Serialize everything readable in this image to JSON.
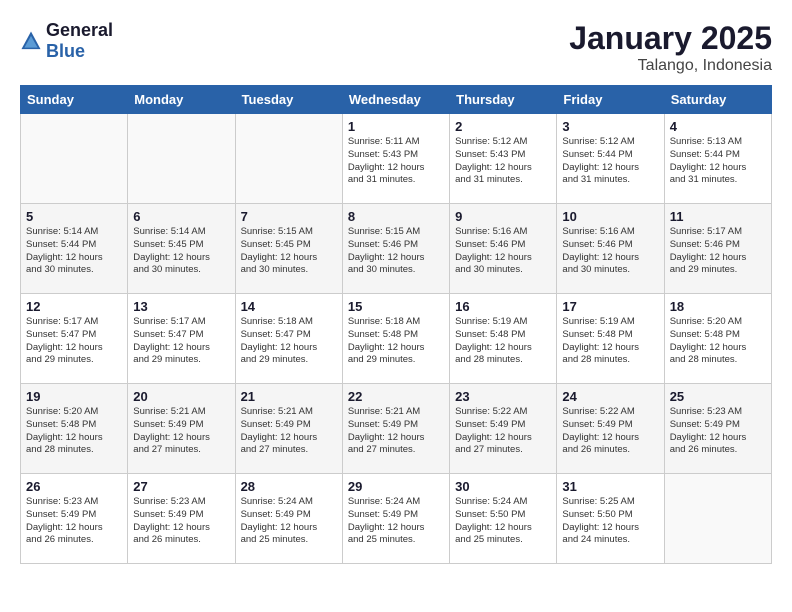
{
  "header": {
    "logo_general": "General",
    "logo_blue": "Blue",
    "title": "January 2025",
    "subtitle": "Talango, Indonesia"
  },
  "days_of_week": [
    "Sunday",
    "Monday",
    "Tuesday",
    "Wednesday",
    "Thursday",
    "Friday",
    "Saturday"
  ],
  "weeks": [
    [
      {
        "day": "",
        "info": ""
      },
      {
        "day": "",
        "info": ""
      },
      {
        "day": "",
        "info": ""
      },
      {
        "day": "1",
        "info": "Sunrise: 5:11 AM\nSunset: 5:43 PM\nDaylight: 12 hours\nand 31 minutes."
      },
      {
        "day": "2",
        "info": "Sunrise: 5:12 AM\nSunset: 5:43 PM\nDaylight: 12 hours\nand 31 minutes."
      },
      {
        "day": "3",
        "info": "Sunrise: 5:12 AM\nSunset: 5:44 PM\nDaylight: 12 hours\nand 31 minutes."
      },
      {
        "day": "4",
        "info": "Sunrise: 5:13 AM\nSunset: 5:44 PM\nDaylight: 12 hours\nand 31 minutes."
      }
    ],
    [
      {
        "day": "5",
        "info": "Sunrise: 5:14 AM\nSunset: 5:44 PM\nDaylight: 12 hours\nand 30 minutes."
      },
      {
        "day": "6",
        "info": "Sunrise: 5:14 AM\nSunset: 5:45 PM\nDaylight: 12 hours\nand 30 minutes."
      },
      {
        "day": "7",
        "info": "Sunrise: 5:15 AM\nSunset: 5:45 PM\nDaylight: 12 hours\nand 30 minutes."
      },
      {
        "day": "8",
        "info": "Sunrise: 5:15 AM\nSunset: 5:46 PM\nDaylight: 12 hours\nand 30 minutes."
      },
      {
        "day": "9",
        "info": "Sunrise: 5:16 AM\nSunset: 5:46 PM\nDaylight: 12 hours\nand 30 minutes."
      },
      {
        "day": "10",
        "info": "Sunrise: 5:16 AM\nSunset: 5:46 PM\nDaylight: 12 hours\nand 30 minutes."
      },
      {
        "day": "11",
        "info": "Sunrise: 5:17 AM\nSunset: 5:46 PM\nDaylight: 12 hours\nand 29 minutes."
      }
    ],
    [
      {
        "day": "12",
        "info": "Sunrise: 5:17 AM\nSunset: 5:47 PM\nDaylight: 12 hours\nand 29 minutes."
      },
      {
        "day": "13",
        "info": "Sunrise: 5:17 AM\nSunset: 5:47 PM\nDaylight: 12 hours\nand 29 minutes."
      },
      {
        "day": "14",
        "info": "Sunrise: 5:18 AM\nSunset: 5:47 PM\nDaylight: 12 hours\nand 29 minutes."
      },
      {
        "day": "15",
        "info": "Sunrise: 5:18 AM\nSunset: 5:48 PM\nDaylight: 12 hours\nand 29 minutes."
      },
      {
        "day": "16",
        "info": "Sunrise: 5:19 AM\nSunset: 5:48 PM\nDaylight: 12 hours\nand 28 minutes."
      },
      {
        "day": "17",
        "info": "Sunrise: 5:19 AM\nSunset: 5:48 PM\nDaylight: 12 hours\nand 28 minutes."
      },
      {
        "day": "18",
        "info": "Sunrise: 5:20 AM\nSunset: 5:48 PM\nDaylight: 12 hours\nand 28 minutes."
      }
    ],
    [
      {
        "day": "19",
        "info": "Sunrise: 5:20 AM\nSunset: 5:48 PM\nDaylight: 12 hours\nand 28 minutes."
      },
      {
        "day": "20",
        "info": "Sunrise: 5:21 AM\nSunset: 5:49 PM\nDaylight: 12 hours\nand 27 minutes."
      },
      {
        "day": "21",
        "info": "Sunrise: 5:21 AM\nSunset: 5:49 PM\nDaylight: 12 hours\nand 27 minutes."
      },
      {
        "day": "22",
        "info": "Sunrise: 5:21 AM\nSunset: 5:49 PM\nDaylight: 12 hours\nand 27 minutes."
      },
      {
        "day": "23",
        "info": "Sunrise: 5:22 AM\nSunset: 5:49 PM\nDaylight: 12 hours\nand 27 minutes."
      },
      {
        "day": "24",
        "info": "Sunrise: 5:22 AM\nSunset: 5:49 PM\nDaylight: 12 hours\nand 26 minutes."
      },
      {
        "day": "25",
        "info": "Sunrise: 5:23 AM\nSunset: 5:49 PM\nDaylight: 12 hours\nand 26 minutes."
      }
    ],
    [
      {
        "day": "26",
        "info": "Sunrise: 5:23 AM\nSunset: 5:49 PM\nDaylight: 12 hours\nand 26 minutes."
      },
      {
        "day": "27",
        "info": "Sunrise: 5:23 AM\nSunset: 5:49 PM\nDaylight: 12 hours\nand 26 minutes."
      },
      {
        "day": "28",
        "info": "Sunrise: 5:24 AM\nSunset: 5:49 PM\nDaylight: 12 hours\nand 25 minutes."
      },
      {
        "day": "29",
        "info": "Sunrise: 5:24 AM\nSunset: 5:49 PM\nDaylight: 12 hours\nand 25 minutes."
      },
      {
        "day": "30",
        "info": "Sunrise: 5:24 AM\nSunset: 5:50 PM\nDaylight: 12 hours\nand 25 minutes."
      },
      {
        "day": "31",
        "info": "Sunrise: 5:25 AM\nSunset: 5:50 PM\nDaylight: 12 hours\nand 24 minutes."
      },
      {
        "day": "",
        "info": ""
      }
    ]
  ]
}
